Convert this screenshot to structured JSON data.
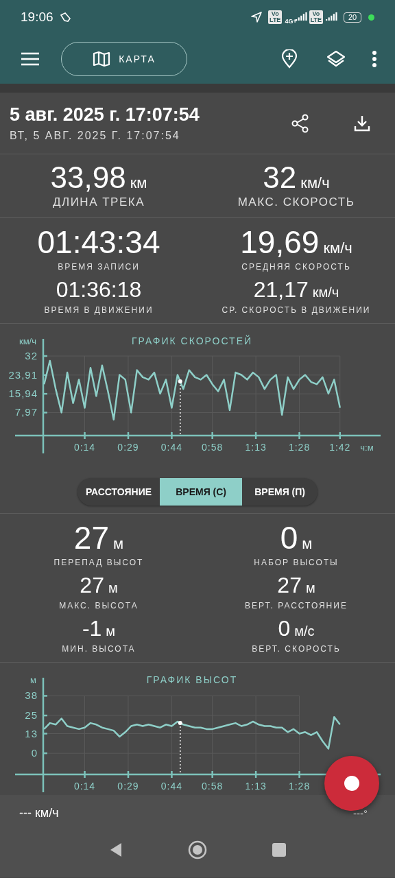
{
  "status_bar": {
    "time": "19:06",
    "network": "4G+",
    "volte": [
      {
        "top": "Vo",
        "bottom": "LTE"
      },
      {
        "top": "Vo",
        "bottom": "LTE"
      }
    ],
    "battery": "20"
  },
  "toolbar": {
    "map_button": "КАРТА"
  },
  "track": {
    "title": "5 авг. 2025 г. 17:07:54",
    "subtitle": "ВТ, 5 АВГ. 2025 Г. 17:07:54"
  },
  "sections": [
    {
      "kind": "stats",
      "stats": [
        {
          "kind": "hero",
          "value": "33,98",
          "unit": "км",
          "label": "ДЛИНА ТРЕКА"
        },
        {
          "kind": "hero",
          "value": "32",
          "unit": "км/ч",
          "label": "МАКС. СКОРОСТЬ"
        }
      ]
    },
    {
      "kind": "stats",
      "stats": [
        {
          "kind": "primary",
          "value": "01:43:34",
          "label": "ВРЕМЯ ЗАПИСИ"
        },
        {
          "kind": "primary",
          "value": "19,69",
          "unit": "км/ч",
          "label": "СРЕДНЯЯ СКОРОСТЬ"
        },
        {
          "kind": "secondary",
          "value": "01:36:18",
          "label": "ВРЕМЯ В ДВИЖЕНИИ"
        },
        {
          "kind": "secondary",
          "value": "21,17",
          "unit": "км/ч",
          "label": "СР. СКОРОСТЬ В ДВИЖЕНИИ"
        }
      ]
    },
    {
      "kind": "chart",
      "cursor": {
        "level": 0.46
      },
      "chart_data": {
        "type": "line",
        "title": "ГРАФИК СКОРОСТЕЙ",
        "xlabel": "ч:м",
        "ylabel": "км/ч",
        "grid": true,
        "xlim": [
          -10,
          116
        ],
        "ylim": [
          -1.8,
          39.3
        ],
        "xticks": [
          {
            "value": 14,
            "label": "0:14"
          },
          {
            "value": 29,
            "label": "0:29"
          },
          {
            "value": 44,
            "label": "0:44"
          },
          {
            "value": 58,
            "label": "0:58"
          },
          {
            "value": 73,
            "label": "1:13"
          },
          {
            "value": 88,
            "label": "1:28"
          },
          {
            "value": 102,
            "label": "1:42"
          }
        ],
        "yticks": [
          {
            "value": 32,
            "label": "32"
          },
          {
            "value": 23.91,
            "label": "23,91"
          },
          {
            "value": 15.94,
            "label": "15,94"
          },
          {
            "value": 7.97,
            "label": "7,97"
          }
        ],
        "x": [
          0,
          2,
          4,
          6,
          8,
          10,
          12,
          14,
          16,
          18,
          20,
          22,
          24,
          26,
          28,
          30,
          32,
          34,
          36,
          38,
          40,
          42,
          44,
          46,
          48,
          50,
          52,
          54,
          56,
          58,
          60,
          62,
          64,
          66,
          68,
          70,
          72,
          74,
          76,
          78,
          80,
          82,
          84,
          86,
          88,
          90,
          92,
          94,
          96,
          98,
          100,
          102
        ],
        "series": [
          {
            "color": "#8ecfc8",
            "values": [
              20,
              30,
              18,
              8,
              25,
              12,
              22,
              10,
              27,
              15,
              28,
              17,
              5,
              24,
              22,
              8,
              26,
              23,
              22,
              25,
              16,
              22,
              10,
              24,
              18,
              26,
              23,
              22,
              24,
              20,
              17,
              22,
              9,
              25,
              24,
              22,
              25,
              23,
              18,
              22,
              24,
              7,
              23,
              18,
              22,
              24,
              21,
              20,
              23,
              16,
              22,
              10
            ]
          }
        ]
      }
    },
    {
      "kind": "modes",
      "tabs": [
        {
          "label": "РАССТОЯНИЕ",
          "selected": false
        },
        {
          "label": "ВРЕМЯ (С)",
          "selected": true
        },
        {
          "label": "ВРЕМЯ (П)",
          "selected": false
        }
      ]
    },
    {
      "kind": "stats",
      "stats": [
        {
          "kind": "primary",
          "value": "27",
          "unit": "м",
          "label": "ПЕРЕПАД ВЫСОТ"
        },
        {
          "kind": "primary",
          "value": "0",
          "unit": "м",
          "label": "НАБОР ВЫСОТЫ"
        },
        {
          "kind": "secondary",
          "value": "27",
          "unit": "м",
          "label": "МАКС. ВЫСОТА"
        },
        {
          "kind": "secondary",
          "value": "27",
          "unit": "м",
          "label": "ВЕРТ. РАССТОЯНИЕ"
        },
        {
          "kind": "secondary",
          "value": "-1",
          "unit": "м",
          "label": "МИН. ВЫСОТА"
        },
        {
          "kind": "secondary",
          "value": "0",
          "unit": "м/с",
          "label": "ВЕРТ. СКОРОСТЬ"
        }
      ]
    },
    {
      "kind": "chart",
      "cursor": {
        "level": 0.46
      },
      "chart_data": {
        "type": "line",
        "title": "ГРАФИК ВЫСОТ",
        "ylabel": "м",
        "grid": true,
        "xlim": [
          -10,
          116
        ],
        "ylim": [
          -14,
          50
        ],
        "xticks": [
          {
            "value": 14,
            "label": "0:14"
          },
          {
            "value": 29,
            "label": "0:29"
          },
          {
            "value": 44,
            "label": "0:44"
          },
          {
            "value": 58,
            "label": "0:58"
          },
          {
            "value": 73,
            "label": "1:13"
          },
          {
            "value": 88,
            "label": "1:28"
          }
        ],
        "yticks": [
          {
            "value": 38,
            "label": "38"
          },
          {
            "value": 25,
            "label": "25"
          },
          {
            "value": 13,
            "label": "13"
          },
          {
            "value": 0,
            "label": "0"
          }
        ],
        "x": [
          0,
          2,
          4,
          6,
          8,
          10,
          12,
          14,
          16,
          18,
          20,
          22,
          24,
          26,
          28,
          30,
          32,
          34,
          36,
          38,
          40,
          42,
          44,
          46,
          48,
          50,
          52,
          54,
          56,
          58,
          60,
          62,
          64,
          66,
          68,
          70,
          72,
          74,
          76,
          78,
          80,
          82,
          84,
          86,
          88,
          90,
          92,
          94,
          96,
          98,
          100,
          102
        ],
        "series": [
          {
            "color": "#8ecfc8",
            "values": [
              16,
              20,
              19,
              23,
              18,
              17,
              16,
              17,
              20,
              19,
              17,
              16,
              15,
              11,
              14,
              18,
              19,
              18,
              19,
              18,
              17,
              19,
              18,
              21,
              19,
              18,
              17,
              17,
              16,
              16,
              17,
              18,
              19,
              20,
              18,
              19,
              21,
              19,
              18,
              18,
              17,
              17,
              14,
              16,
              13,
              14,
              12,
              14,
              8,
              3,
              24,
              19
            ]
          }
        ]
      }
    }
  ],
  "bottom_bar": {
    "speed": "--- км/ч",
    "heading": "---°"
  }
}
